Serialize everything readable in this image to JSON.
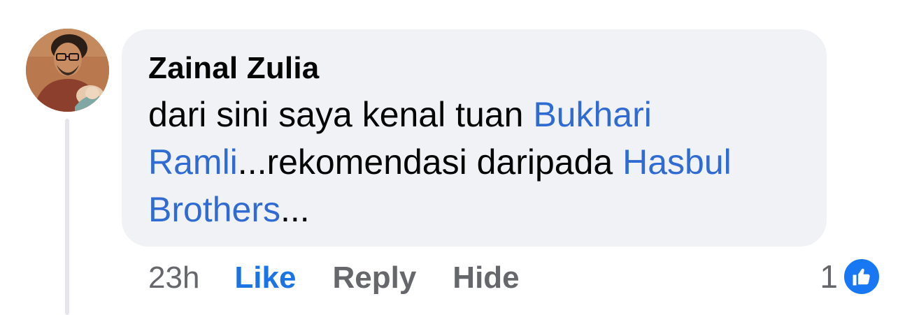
{
  "comment": {
    "author": "Zainal Zulia",
    "text_segments": [
      {
        "type": "text",
        "value": "dari sini saya kenal tuan "
      },
      {
        "type": "mention",
        "value": "Bukhari Ramli"
      },
      {
        "type": "text",
        "value": "...rekomendasi daripada "
      },
      {
        "type": "mention",
        "value": "Hasbul Brothers"
      },
      {
        "type": "text",
        "value": "..."
      }
    ],
    "timestamp": "23h",
    "like_label": "Like",
    "reply_label": "Reply",
    "hide_label": "Hide",
    "reaction_count": "1",
    "reaction_icon": "thumbs-up-icon"
  },
  "colors": {
    "mention": "#2f6bd2",
    "like_action": "#1b74e4",
    "bubble_bg": "#f0f2f5",
    "muted_text": "#65676b",
    "like_badge": "#1877f2"
  }
}
